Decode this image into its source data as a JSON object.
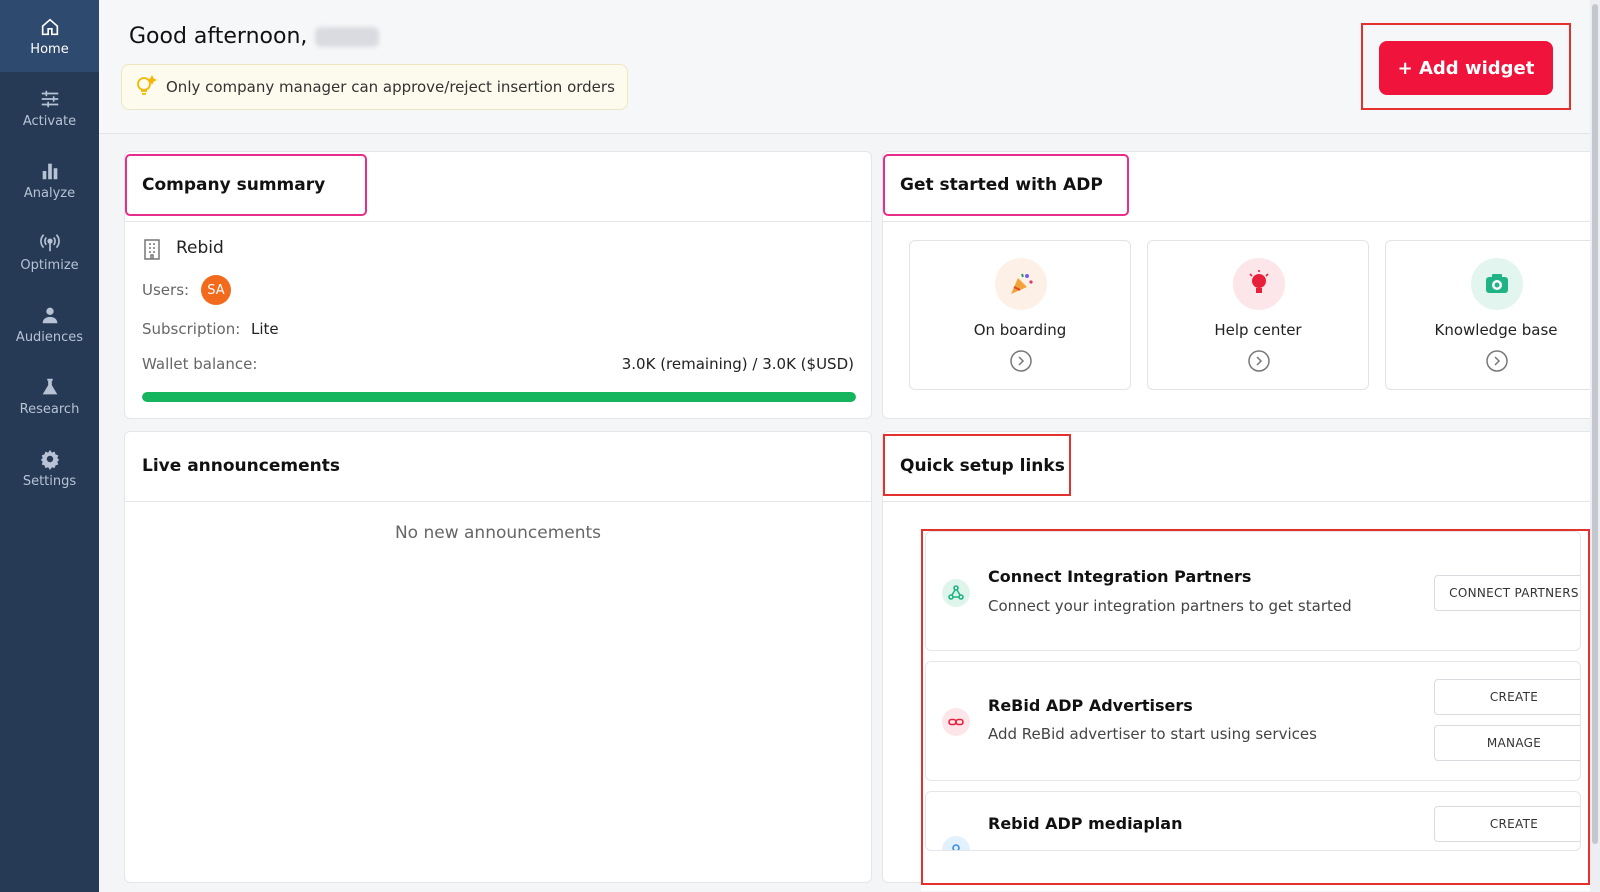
{
  "sidebar": {
    "items": [
      {
        "label": "Home",
        "icon": "home-icon",
        "active": true
      },
      {
        "label": "Activate",
        "icon": "sliders-icon"
      },
      {
        "label": "Analyze",
        "icon": "bar-chart-icon"
      },
      {
        "label": "Optimize",
        "icon": "broadcast-icon"
      },
      {
        "label": "Audiences",
        "icon": "users-icon"
      },
      {
        "label": "Research",
        "icon": "flask-icon"
      },
      {
        "label": "Settings",
        "icon": "gear-icon"
      }
    ]
  },
  "header": {
    "greeting": "Good afternoon,",
    "notice": "Only company manager can approve/reject insertion orders",
    "add_widget_label": "+ Add widget"
  },
  "company_summary": {
    "title": "Company summary",
    "company_name": "Rebid",
    "users_label": "Users:",
    "user_initials": "SA",
    "subscription_label": "Subscription:",
    "subscription_value": "Lite",
    "wallet_label": "Wallet balance:",
    "wallet_value": "3.0K (remaining) / 3.0K ($USD)",
    "wallet_remaining_fraction": 1.0
  },
  "get_started": {
    "title": "Get started with ADP",
    "tiles": [
      {
        "label": "On boarding",
        "icon": "party-popper-icon"
      },
      {
        "label": "Help center",
        "icon": "lightbulb-icon"
      },
      {
        "label": "Knowledge base",
        "icon": "camera-icon"
      }
    ]
  },
  "live_announcements": {
    "title": "Live announcements",
    "empty_text": "No new announcements"
  },
  "quick_setup": {
    "title": "Quick setup links",
    "items": [
      {
        "title": "Connect Integration Partners",
        "desc": "Connect your integration partners to get started",
        "icon": "share-nodes-icon",
        "buttons": [
          "CONNECT PARTNERS"
        ]
      },
      {
        "title": "ReBid ADP Advertisers",
        "desc": "Add ReBid advertiser to start using services",
        "icon": "link-icon",
        "buttons": [
          "CREATE",
          "MANAGE"
        ]
      },
      {
        "title": "Rebid ADP mediaplan",
        "desc": "",
        "icon": "pin-icon",
        "buttons": [
          "CREATE"
        ]
      }
    ]
  },
  "colors": {
    "sidebar_bg": "#263a55",
    "accent_red": "#f0143c",
    "progress_green": "#14b55e",
    "avatar_orange": "#f26b1d"
  }
}
